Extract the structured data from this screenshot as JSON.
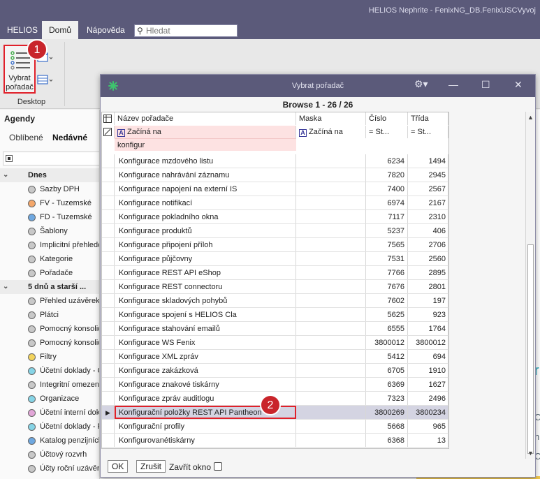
{
  "window": {
    "title": "HELIOS Nephrite - FenixNG_DB.FenixUSCVyvoj"
  },
  "menubar": {
    "items": [
      "HELIOS",
      "Domů",
      "Nápověda"
    ],
    "search_placeholder": "Hledat"
  },
  "ribbon": {
    "button_label_1": "Vybrat",
    "button_label_2": "pořadač",
    "group_label": "Desktop",
    "badge1": "1"
  },
  "left_panel": {
    "heading": "Agendy",
    "tabs": [
      "Oblíbené",
      "Nedávné"
    ],
    "groups": [
      {
        "label": "Dnes",
        "items": [
          {
            "label": "Sazby DPH",
            "color": "#c8c8c8"
          },
          {
            "label": "FV - Tuzemské",
            "color": "#f4a76a"
          },
          {
            "label": "FD - Tuzemské",
            "color": "#6fa8e0"
          },
          {
            "label": "Šablony",
            "color": "#c8c8c8"
          },
          {
            "label": "Implicitní přehledo",
            "color": "#c8c8c8"
          },
          {
            "label": "Kategorie",
            "color": "#c8c8c8"
          },
          {
            "label": "Pořadače",
            "color": "#c8c8c8"
          }
        ]
      },
      {
        "label": "5 dnů a starší ...",
        "items": [
          {
            "label": "Přehled uzávěrek",
            "color": "#c8c8c8"
          },
          {
            "label": "Plátci",
            "color": "#c8c8c8"
          },
          {
            "label": "Pomocný konsolid",
            "color": "#c8c8c8"
          },
          {
            "label": "Pomocný konsolid",
            "color": "#c8c8c8"
          },
          {
            "label": "Filtry",
            "color": "#f2d35c"
          },
          {
            "label": "Účetní doklady - C",
            "color": "#86d4e6"
          },
          {
            "label": "Integritní omezen",
            "color": "#c8c8c8"
          },
          {
            "label": "Organizace",
            "color": "#86d4e6"
          },
          {
            "label": "Účetní interní dokl",
            "color": "#e2a6d8"
          },
          {
            "label": "Účetní doklady - F",
            "color": "#86d4e6"
          },
          {
            "label": "Katalog penzijních",
            "color": "#6fa8e0"
          },
          {
            "label": "Účtový rozvrh",
            "color": "#c8c8c8"
          },
          {
            "label": "Účty roční uzávěr",
            "color": "#c8c8c8"
          }
        ]
      }
    ]
  },
  "dialog": {
    "title": "Vybrat pořadač",
    "browse_header": "Browse  1 - 26 / 26",
    "columns": [
      "Název pořadače",
      "Maska",
      "Číslo",
      "Třída"
    ],
    "filters": {
      "name_op": "Začíná na",
      "name_value": "konfigur",
      "mask_op": "Začíná na",
      "cislo_op": "= St...",
      "trida_op": "= St..."
    },
    "rows": [
      {
        "name": "Konfigurace mzdového listu",
        "mask": "",
        "cislo": "6234",
        "trida": "1494"
      },
      {
        "name": "Konfigurace nahrávání záznamu",
        "mask": "",
        "cislo": "7820",
        "trida": "2945"
      },
      {
        "name": "Konfigurace napojení na externí IS",
        "mask": "",
        "cislo": "7400",
        "trida": "2567"
      },
      {
        "name": "Konfigurace notifikací",
        "mask": "",
        "cislo": "6974",
        "trida": "2167"
      },
      {
        "name": "Konfigurace pokladního okna",
        "mask": "",
        "cislo": "7117",
        "trida": "2310"
      },
      {
        "name": "Konfigurace produktů",
        "mask": "",
        "cislo": "5237",
        "trida": "406"
      },
      {
        "name": "Konfigurace připojení příloh",
        "mask": "",
        "cislo": "7565",
        "trida": "2706"
      },
      {
        "name": "Konfigurace půjčovny",
        "mask": "",
        "cislo": "7531",
        "trida": "2560"
      },
      {
        "name": "Konfigurace REST API eShop",
        "mask": "",
        "cislo": "7766",
        "trida": "2895"
      },
      {
        "name": "Konfigurace REST connectoru",
        "mask": "",
        "cislo": "7676",
        "trida": "2801"
      },
      {
        "name": "Konfigurace skladových pohybů",
        "mask": "",
        "cislo": "7602",
        "trida": "197"
      },
      {
        "name": "Konfigurace spojení s HELIOS Cla",
        "mask": "",
        "cislo": "5625",
        "trida": "923"
      },
      {
        "name": "Konfigurace stahování emailů",
        "mask": "",
        "cislo": "6555",
        "trida": "1764"
      },
      {
        "name": "Konfigurace WS Fenix",
        "mask": "",
        "cislo": "3800012",
        "trida": "3800012"
      },
      {
        "name": "Konfigurace XML zpráv",
        "mask": "",
        "cislo": "5412",
        "trida": "694"
      },
      {
        "name": "Konfigurace zakázková",
        "mask": "",
        "cislo": "6705",
        "trida": "1910"
      },
      {
        "name": "Konfigurace znakové tiskárny",
        "mask": "",
        "cislo": "6369",
        "trida": "1627"
      },
      {
        "name": "Konfigurace zpráv auditlogu",
        "mask": "",
        "cislo": "7323",
        "trida": "2496"
      },
      {
        "name": "Konfigurační položky REST API Pantheon",
        "mask": "",
        "cislo": "3800269",
        "trida": "3800234"
      },
      {
        "name": "Konfigurační profily",
        "mask": "",
        "cislo": "5668",
        "trida": "965"
      },
      {
        "name": "Konfigurovanétiskárny",
        "mask": "",
        "cislo": "6368",
        "trida": "13"
      }
    ],
    "selected_row_index": 18,
    "badge2": "2",
    "ok_label": "OK",
    "cancel_label": "Zrušit",
    "close_window_label": "Zavřít okno"
  }
}
